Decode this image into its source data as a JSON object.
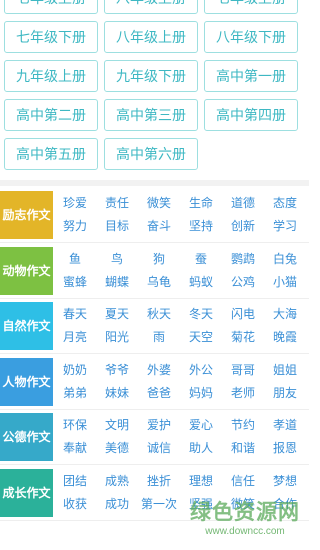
{
  "grade_buttons": [
    [
      "七年级上册",
      "八年级上册",
      "七年级上册"
    ],
    [
      "七年级下册",
      "八年级上册",
      "八年级下册"
    ],
    [
      "九年级上册",
      "九年级下册",
      "高中第一册"
    ],
    [
      "高中第二册",
      "高中第三册",
      "高中第四册"
    ],
    [
      "高中第五册",
      "高中第六册"
    ]
  ],
  "categories": [
    {
      "label": "励志作文",
      "color": "#e3b528",
      "tags": [
        "珍爱",
        "责任",
        "微笑",
        "生命",
        "道德",
        "态度",
        "努力",
        "目标",
        "奋斗",
        "坚持",
        "创新",
        "学习"
      ]
    },
    {
      "label": "动物作文",
      "color": "#7dc142",
      "tags": [
        "鱼",
        "鸟",
        "狗",
        "蚕",
        "鹦鹉",
        "白兔",
        "蜜蜂",
        "蝴蝶",
        "乌龟",
        "蚂蚁",
        "公鸡",
        "小猫"
      ]
    },
    {
      "label": "自然作文",
      "color": "#2ebfe6",
      "tags": [
        "春天",
        "夏天",
        "秋天",
        "冬天",
        "闪电",
        "大海",
        "月亮",
        "阳光",
        "雨",
        "天空",
        "菊花",
        "晚霞"
      ]
    },
    {
      "label": "人物作文",
      "color": "#3a9ee0",
      "tags": [
        "奶奶",
        "爷爷",
        "外婆",
        "外公",
        "哥哥",
        "姐姐",
        "弟弟",
        "妹妹",
        "爸爸",
        "妈妈",
        "老师",
        "朋友"
      ]
    },
    {
      "label": "公德作文",
      "color": "#36a9c9",
      "tags": [
        "环保",
        "文明",
        "爱护",
        "爱心",
        "节约",
        "孝道",
        "奉献",
        "美德",
        "诚信",
        "助人",
        "和谐",
        "报恩"
      ]
    },
    {
      "label": "成长作文",
      "color": "#2bb19a",
      "tags": [
        "团结",
        "成熟",
        "挫折",
        "理想",
        "信任",
        "梦想",
        "收获",
        "成功",
        "第一次",
        "坚强",
        "微笑",
        "合作"
      ]
    }
  ],
  "watermark": {
    "main": "绿色资源网",
    "url": "www.downcc.com"
  }
}
